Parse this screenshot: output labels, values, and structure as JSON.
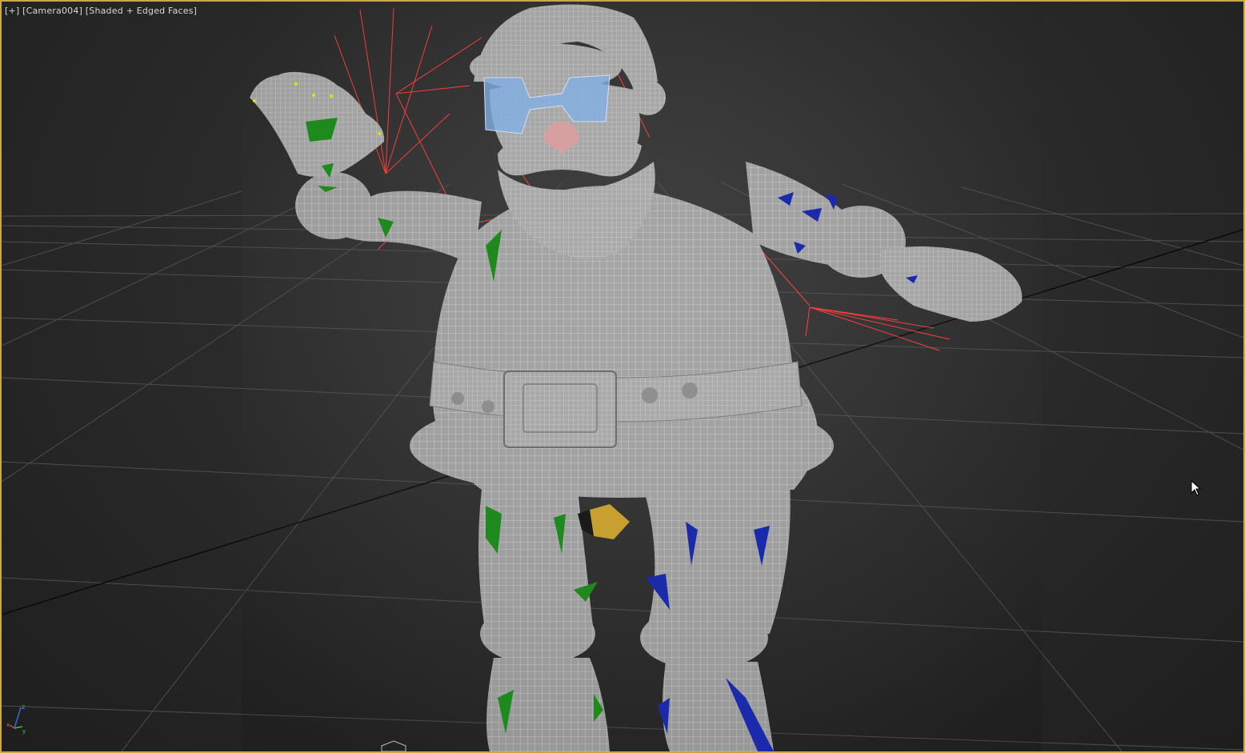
{
  "viewport": {
    "label_plus": "[+]",
    "label_camera": "[Camera004]",
    "label_shading": "[Shaded + Edged Faces]"
  },
  "gizmo": {
    "axis_x": "x",
    "axis_y": "y",
    "axis_z": "z"
  },
  "colors": {
    "border": "#c8a84a",
    "grid": "#505050",
    "grid_major": "#0a0a0a",
    "mesh": "#9e9e9e",
    "mesh_wire": "#e6e6e6",
    "bone_red": "#ff3a3a",
    "green_selection": "#1e8a1e",
    "blue_selection": "#1a2aaa",
    "glasses": "#7fb0e8",
    "nose": "#d9a0a0",
    "buckle_gold": "#c8a030"
  }
}
